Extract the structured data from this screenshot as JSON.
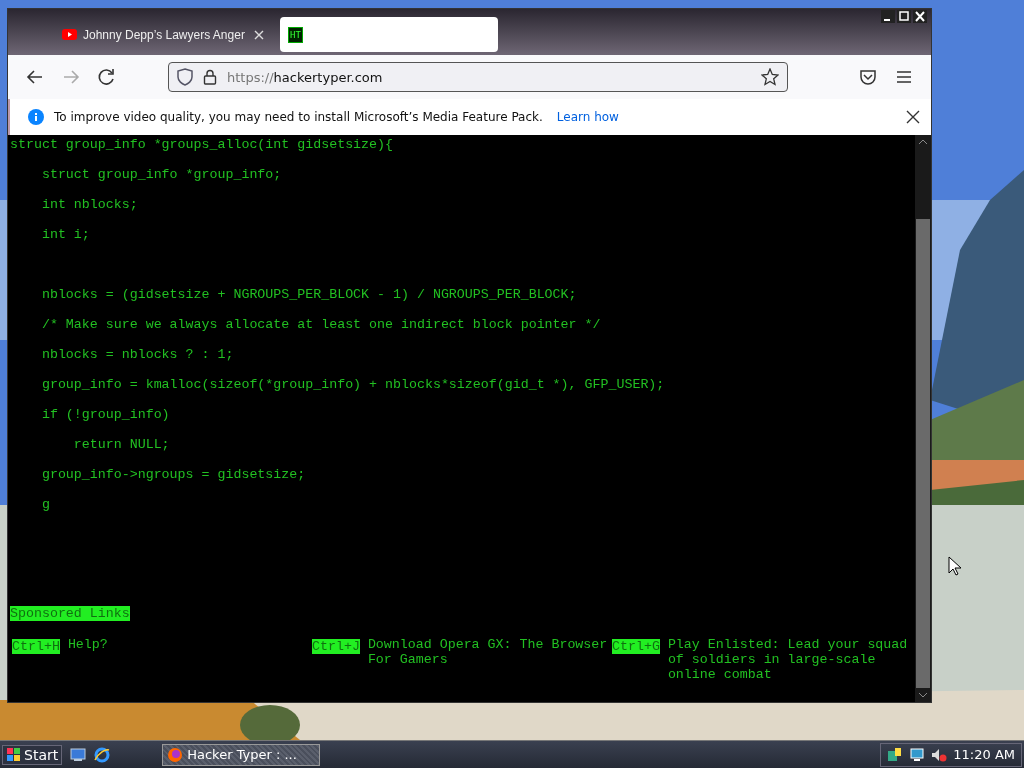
{
  "browser": {
    "tabs": [
      {
        "title": "Johnny Depp’s Lawyers Anger",
        "selected": false,
        "kind": "video"
      },
      {
        "favicon_text": "HT",
        "selected": true,
        "kind": "site"
      }
    ],
    "url_scheme": "https://",
    "url_host": "hackertyper.com",
    "notification": {
      "message": "To improve video quality, you may need to install Microsoft’s Media Feature Pack.",
      "link": "Learn how"
    }
  },
  "page": {
    "code_blocks": [
      [
        "struct group_info *groups_alloc(int gidsetsize){",
        "    struct group_info *group_info;",
        "    int nblocks;",
        "    int i;"
      ],
      [
        "    nblocks = (gidsetsize + NGROUPS_PER_BLOCK - 1) / NGROUPS_PER_BLOCK;",
        "    /* Make sure we always allocate at least one indirect block pointer */",
        "    nblocks = nblocks ? : 1;",
        "    group_info = kmalloc(sizeof(*group_info) + nblocks*sizeof(gid_t *), GFP_USER);",
        "    if (!group_info)",
        "        return NULL;",
        "    group_info->ngroups = gidsetsize;",
        "    g"
      ]
    ],
    "sponsored_label": "Sponsored Links",
    "shortcuts": [
      {
        "keys": "Ctrl+H",
        "text": "Help?"
      },
      {
        "keys": "Ctrl+J",
        "text": "Download Opera GX: The Browser For Gamers"
      },
      {
        "keys": "Ctrl+G",
        "text": "Play Enlisted: Lead your squad of soldiers in large-scale online combat"
      }
    ]
  },
  "taskbar": {
    "start": "Start",
    "task": "Hacker Typer : ...",
    "clock": "11:20 AM"
  }
}
